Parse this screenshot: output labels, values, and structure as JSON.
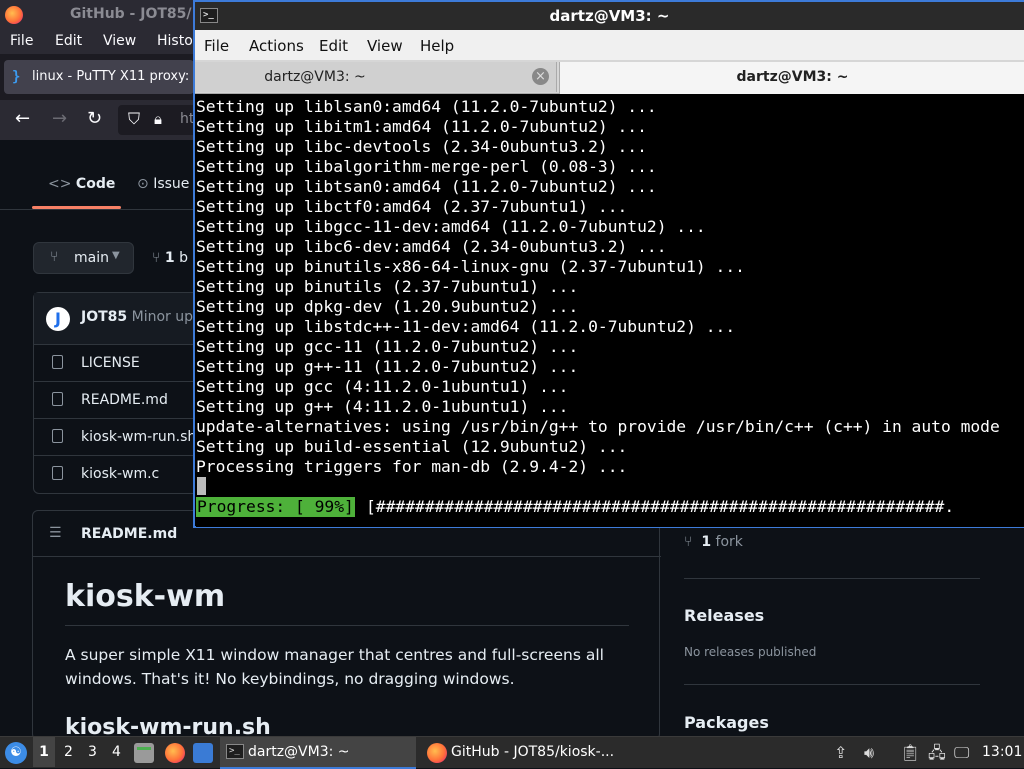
{
  "firefox": {
    "title": "GitHub - JOT85/",
    "menu": [
      "File",
      "Edit",
      "View",
      "Histo"
    ],
    "tab_label": "linux - PuTTY X11 proxy:",
    "url_text": "ht"
  },
  "github": {
    "tabs": {
      "code": "Code",
      "issues": "Issue"
    },
    "branch": "main",
    "branches_count": "1",
    "branches_label": "b",
    "commit": {
      "author": "JOT85",
      "message": "Minor upda",
      "avatar": "J"
    },
    "files": [
      "LICENSE",
      "README.md",
      "kiosk-wm-run.sh",
      "kiosk-wm.c"
    ],
    "readme": {
      "header": "README.md",
      "h1": "kiosk-wm",
      "paragraph": "A super simple X11 window manager that centres and full-screens all windows. That's it! No keybindings, no dragging windows.",
      "h2": "kiosk-wm-run.sh"
    },
    "sidebar": {
      "forks_count": "1",
      "forks_label": "fork",
      "releases_heading": "Releases",
      "releases_text": "No releases published",
      "packages_heading": "Packages"
    }
  },
  "terminal": {
    "window_title": "dartz@VM3: ~",
    "menu": [
      "File",
      "Actions",
      "Edit",
      "View",
      "Help"
    ],
    "tabs": [
      {
        "label": "dartz@VM3: ~",
        "active": false
      },
      {
        "label": "dartz@VM3: ~",
        "active": true
      }
    ],
    "lines": [
      "Setting up liblsan0:amd64 (11.2.0-7ubuntu2) ...",
      "Setting up libitm1:amd64 (11.2.0-7ubuntu2) ...",
      "Setting up libc-devtools (2.34-0ubuntu3.2) ...",
      "Setting up libalgorithm-merge-perl (0.08-3) ...",
      "Setting up libtsan0:amd64 (11.2.0-7ubuntu2) ...",
      "Setting up libctf0:amd64 (2.37-7ubuntu1) ...",
      "Setting up libgcc-11-dev:amd64 (11.2.0-7ubuntu2) ...",
      "Setting up libc6-dev:amd64 (2.34-0ubuntu3.2) ...",
      "Setting up binutils-x86-64-linux-gnu (2.37-7ubuntu1) ...",
      "Setting up binutils (2.37-7ubuntu1) ...",
      "Setting up dpkg-dev (1.20.9ubuntu2) ...",
      "Setting up libstdc++-11-dev:amd64 (11.2.0-7ubuntu2) ...",
      "Setting up gcc-11 (11.2.0-7ubuntu2) ...",
      "Setting up g++-11 (11.2.0-7ubuntu2) ...",
      "Setting up gcc (4:11.2.0-1ubuntu1) ...",
      "Setting up g++ (4:11.2.0-1ubuntu1) ...",
      "update-alternatives: using /usr/bin/g++ to provide /usr/bin/c++ (c++) in auto mode",
      "Setting up build-essential (12.9ubuntu2) ...",
      "Processing triggers for man-db (2.9.4-2) ..."
    ],
    "progress_label": "Progress: [ 99%]",
    "progress_bar": "[##########################################################.",
    "progress_color": "#4eb13a"
  },
  "taskbar": {
    "start_icon": "lxqt-start-icon",
    "workspaces": [
      "1",
      "2",
      "3",
      "4"
    ],
    "tasks": [
      {
        "label": "dartz@VM3: ~",
        "active": true
      },
      {
        "label": "GitHub - JOT85/kiosk-...",
        "active": false
      }
    ],
    "clock": "13:01"
  }
}
